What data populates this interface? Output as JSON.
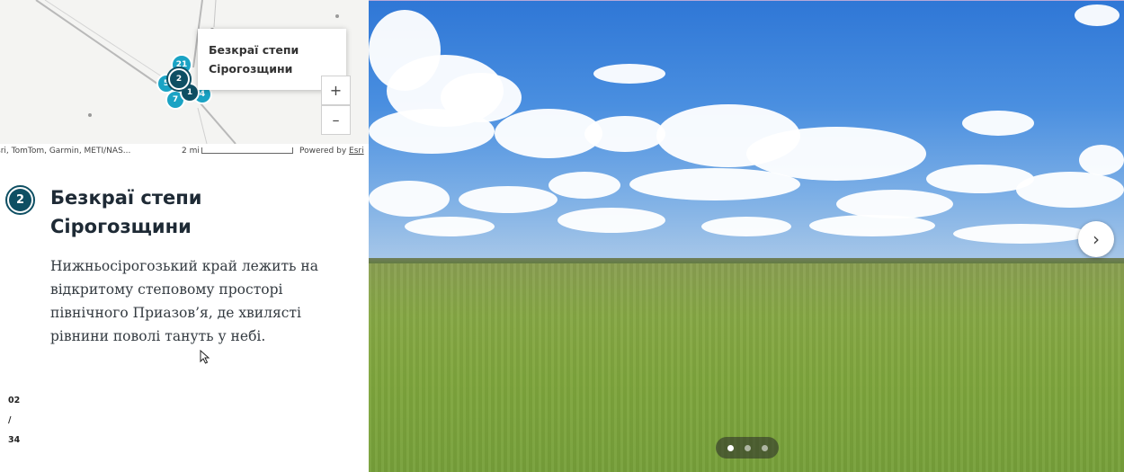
{
  "map": {
    "popup_title_lines": [
      "Безкраї степи",
      "Сірогозщини"
    ],
    "zoom_in": "+",
    "zoom_out": "–",
    "clusters": [
      {
        "label": "21"
      },
      {
        "label": "2"
      },
      {
        "label": "1"
      },
      {
        "label": "5"
      },
      {
        "label": "7"
      },
      {
        "label": "4"
      }
    ],
    "attribution": "sri, TomTom, Garmin, METI/NAS...",
    "scale_label": "2 mi",
    "powered_by_prefix": "Powered by",
    "powered_by_link": "Esri"
  },
  "story": {
    "step_number": "2",
    "title_lines": [
      "Безкраї степи",
      "Сірогозщини"
    ],
    "body_lines": [
      "Нижньосірогозький край лежить на",
      "відкритому степовому просторі",
      "північного Приазов’я, де хвилясті",
      "рівнини поволі тануть у небі."
    ]
  },
  "counter": {
    "current": "02",
    "separator": "/",
    "total": "34"
  },
  "gallery": {
    "next_icon": "›",
    "slide_count": 3,
    "active_slide": 1
  },
  "colors": {
    "accent": "#0e4f63",
    "cluster": "#1aa3c4"
  }
}
